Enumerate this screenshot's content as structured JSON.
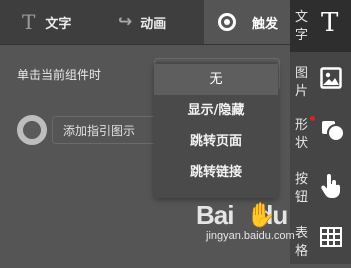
{
  "tabs": {
    "text": {
      "label": "文字",
      "icon": "T"
    },
    "animation": {
      "label": "动画",
      "icon": "↪"
    },
    "trigger": {
      "label": "触发"
    }
  },
  "rail": {
    "text": {
      "label": "文字",
      "icon": "T"
    },
    "image": {
      "label": "图片"
    },
    "shape": {
      "label": "形状"
    },
    "button": {
      "label": "按钮"
    },
    "table": {
      "label": "表格"
    }
  },
  "trigger": {
    "click_label": "单击当前组件时",
    "guide_button": "添加指引图示",
    "options": [
      "无",
      "显示/隐藏",
      "跳转页面",
      "跳转链接"
    ],
    "selected": "无"
  },
  "watermark": {
    "brand": "Bai",
    "brand_tail": "du",
    "url": "jingyan.baidu.com"
  },
  "colors": {
    "panel": "#555555",
    "tabbar": "#3e3e3e",
    "rail": "#454545",
    "badge": "#e02020"
  }
}
